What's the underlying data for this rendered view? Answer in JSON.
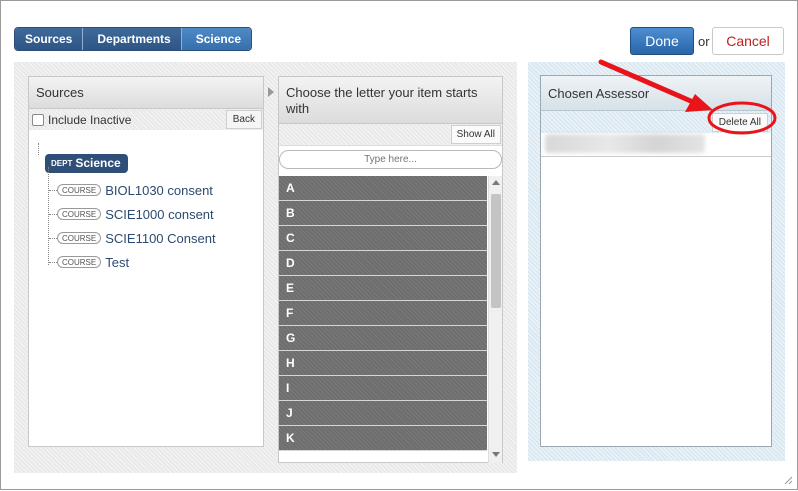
{
  "breadcrumb": [
    "Sources",
    "Departments",
    "Science"
  ],
  "actions": {
    "done": "Done",
    "or": "or",
    "cancel": "Cancel"
  },
  "sources_panel": {
    "title": "Sources",
    "include_inactive": "Include Inactive",
    "back": "Back",
    "department": {
      "tag": "DEPT",
      "name": "Science"
    },
    "courses": [
      {
        "tag": "COURSE",
        "name": "BIOL1030 consent"
      },
      {
        "tag": "COURSE",
        "name": "SCIE1000 consent"
      },
      {
        "tag": "COURSE",
        "name": "SCIE1100 Consent"
      },
      {
        "tag": "COURSE",
        "name": "Test"
      }
    ]
  },
  "letters_panel": {
    "title": "Choose the letter your item starts with",
    "show_all": "Show All",
    "search_placeholder": "Type here...",
    "letters": [
      "A",
      "B",
      "C",
      "D",
      "E",
      "F",
      "G",
      "H",
      "I",
      "J",
      "K"
    ]
  },
  "chosen_panel": {
    "title": "Chosen Assessor",
    "delete_all": "Delete All"
  },
  "colors": {
    "breadcrumb": "#2d5585",
    "done": "#2a65a8",
    "cancel_text": "#c02020",
    "annotation": "#e8141a"
  }
}
